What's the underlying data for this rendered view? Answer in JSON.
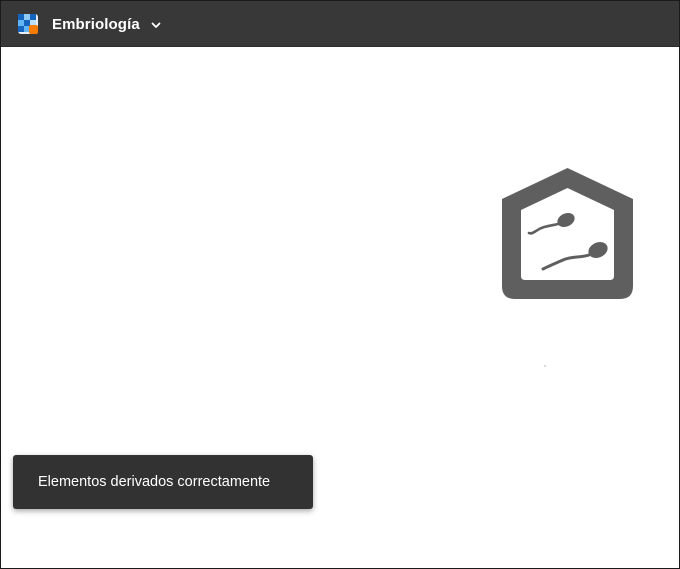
{
  "app": {
    "title": "Embriología",
    "switcher_icon": "chevron-down-icon",
    "logo_icon": "app-logo-icon"
  },
  "main": {
    "brand_icon": "house-with-sperm-icon",
    "brand_color": "#5f5f5f"
  },
  "toast": {
    "message": "Elementos derivados correctamente"
  },
  "colors": {
    "topbar": "#383838",
    "toast": "#323232",
    "logo_blue": "#1565c0",
    "logo_light_blue": "#64b5f6",
    "logo_orange": "#f57c00"
  }
}
